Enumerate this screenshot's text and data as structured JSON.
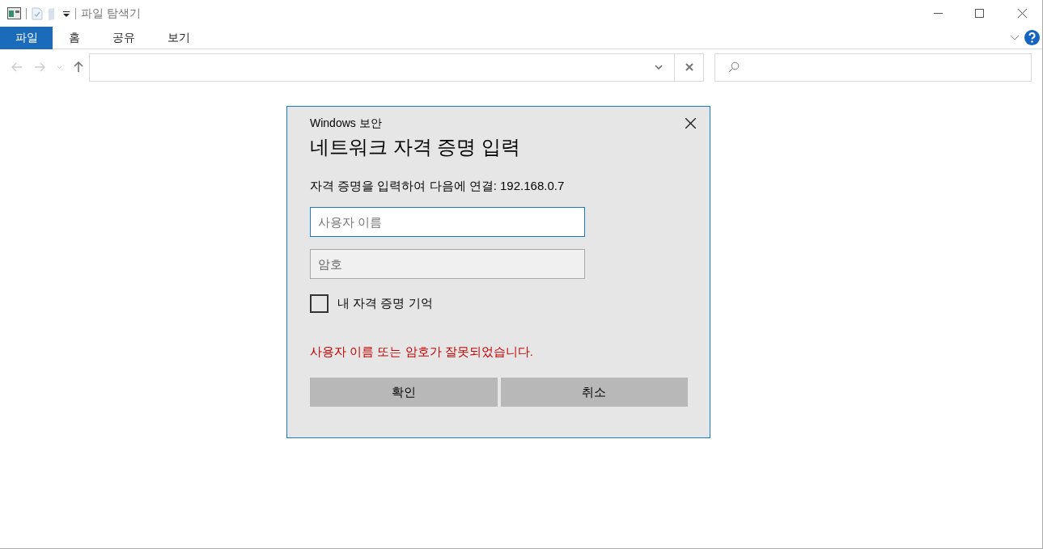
{
  "window": {
    "title": "파일 탐색기"
  },
  "ribbon_tabs": [
    {
      "label": "파일",
      "selected": true
    },
    {
      "label": "홈",
      "selected": false
    },
    {
      "label": "공유",
      "selected": false
    },
    {
      "label": "보기",
      "selected": false
    }
  ],
  "dialog": {
    "app_name": "Windows 보안",
    "heading": "네트워크 자격 증명 입력",
    "message": "자격 증명을 입력하여 다음에 연결: 192.168.0.7",
    "fields": [
      {
        "placeholder": "사용자 이름",
        "focused": true
      },
      {
        "placeholder": "암호",
        "focused": false
      }
    ],
    "remember": {
      "label": "내 자격 증명 기억",
      "checked": false
    },
    "error": "사용자 이름 또는 암호가 잘못되었습니다.",
    "buttons": [
      "확인",
      "취소"
    ]
  }
}
